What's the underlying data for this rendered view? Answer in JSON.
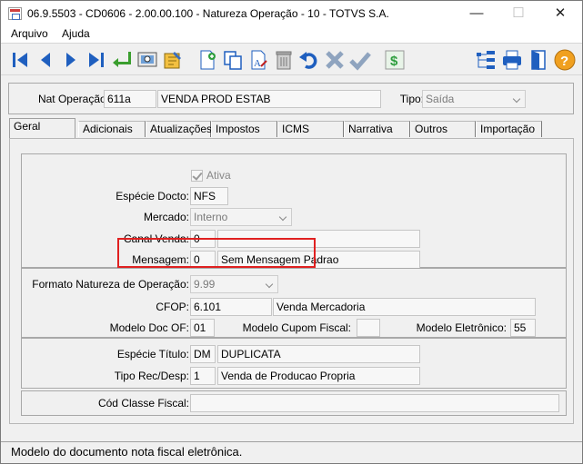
{
  "window": {
    "title": "06.9.5503 - CD0606 - 2.00.00.100 - Natureza Operação - 10 - TOTVS S.A."
  },
  "menu": {
    "items": [
      "Arquivo",
      "Ajuda"
    ]
  },
  "toolbar": {
    "icons": [
      "first-record-icon",
      "previous-record-icon",
      "next-record-icon",
      "last-record-icon",
      "go-to-icon",
      "search-icon",
      "zoom-edit-icon",
      "add-icon",
      "copy-icon",
      "modify-icon",
      "delete-icon",
      "undo-icon",
      "cancel-icon",
      "confirm-icon",
      "money-icon",
      "tree-icon",
      "print-icon",
      "exit-icon",
      "help-icon"
    ]
  },
  "header": {
    "nat_label": "Nat Operação:",
    "nat_code": "611a",
    "nat_desc": "VENDA PROD ESTAB",
    "tipo_label": "Tipo:",
    "tipo_value": "Saída"
  },
  "tabs": [
    "Geral",
    "Adicionais",
    "Atualizações",
    "Impostos",
    "ICMS",
    "Narrativa",
    "Outros",
    "Importação"
  ],
  "form": {
    "ativa_label": "Ativa",
    "especie_docto_label": "Espécie Docto:",
    "especie_docto_value": "NFS",
    "mercado_label": "Mercado:",
    "mercado_value": "Interno",
    "canal_label": "Canal Venda:",
    "canal_code": "0",
    "canal_desc": "",
    "mensagem_label": "Mensagem:",
    "mensagem_code": "0",
    "mensagem_desc": "Sem Mensagem Padrao",
    "formato_label": "Formato Natureza de Operação:",
    "formato_value": "9.99",
    "cfop_label": "CFOP:",
    "cfop_code": "6.101",
    "cfop_desc": "Venda Mercadoria",
    "modelo_doc_label": "Modelo Doc OF:",
    "modelo_doc_value": "01",
    "modelo_cupom_label": "Modelo Cupom Fiscal:",
    "modelo_cupom_value": "",
    "modelo_eletronico_label": "Modelo Eletrônico:",
    "modelo_eletronico_value": "55",
    "especie_titulo_label": "Espécie Título:",
    "especie_titulo_code": "DM",
    "especie_titulo_desc": "DUPLICATA",
    "tipo_rec_label": "Tipo Rec/Desp:",
    "tipo_rec_code": "1",
    "tipo_rec_desc": "Venda de Producao Propria",
    "cod_classe_label": "Cód Classe Fiscal:",
    "cod_classe_value": ""
  },
  "status": {
    "text": "Modelo do documento nota fiscal eletrônica."
  },
  "colors": {
    "toolbar_blue": "#1f5fbf",
    "highlight": "#e02020",
    "help": "#f0a020",
    "green": "#2e9e3e"
  }
}
